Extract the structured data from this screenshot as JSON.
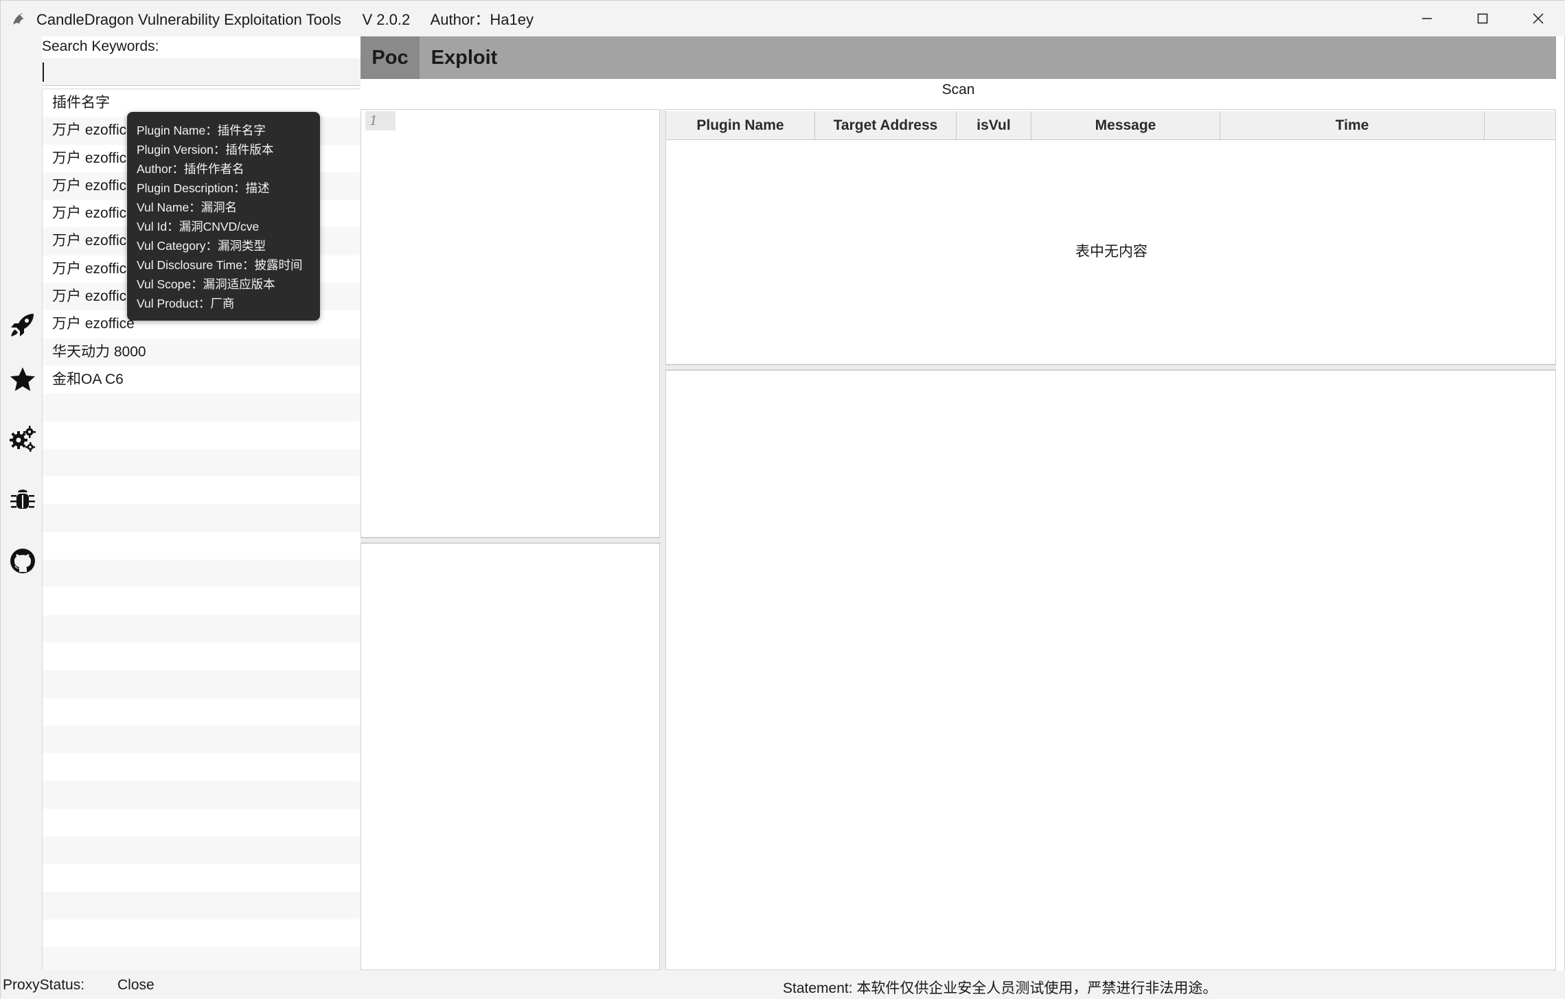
{
  "window": {
    "title": "CandleDragon Vulnerability Exploitation Tools     V 2.0.2     Author：Ha1ey",
    "minimize_icon": "minimize-icon",
    "maximize_icon": "maximize-icon",
    "close_icon": "close-icon"
  },
  "sidebar_icons": [
    "rocket-icon",
    "star-icon",
    "gears-icon",
    "bug-icon",
    "github-icon"
  ],
  "search": {
    "label": "Search Keywords:",
    "value": "",
    "placeholder": ""
  },
  "plugins": [
    "插件名字",
    "万户 ezoffice",
    "万户 ezoffice",
    "万户 ezoffice",
    "万户 ezoffice",
    "万户 ezoffice",
    "万户 ezoffice",
    "万户 ezoffice",
    "万户 ezoffice",
    "华天动力 8000",
    "金和OA C6"
  ],
  "tooltip": {
    "lines": [
      "Plugin Name：插件名字",
      "Plugin Version：插件版本",
      "Author：插件作者名",
      "Plugin Description：描述",
      "Vul Name：漏洞名",
      "Vul Id：漏洞CNVD/cve",
      "Vul Category：漏洞类型",
      "Vul Disclosure Time：披露时间",
      "Vul Scope：漏洞适应版本",
      "Vul Product：厂商"
    ]
  },
  "tabs": [
    {
      "label": "Poc",
      "active": true
    },
    {
      "label": "Exploit",
      "active": false
    }
  ],
  "scan_label": "Scan",
  "editor": {
    "line_number": "1"
  },
  "results_table": {
    "columns": [
      "Plugin Name",
      "Target Address",
      "isVul",
      "Message",
      "Time"
    ],
    "empty_text": "表中无内容"
  },
  "status": {
    "proxy_label": "ProxyStatus:",
    "proxy_value": "Close",
    "statement": "Statement: 本软件仅供企业安全人员测试使用，严禁进行非法用途。"
  }
}
